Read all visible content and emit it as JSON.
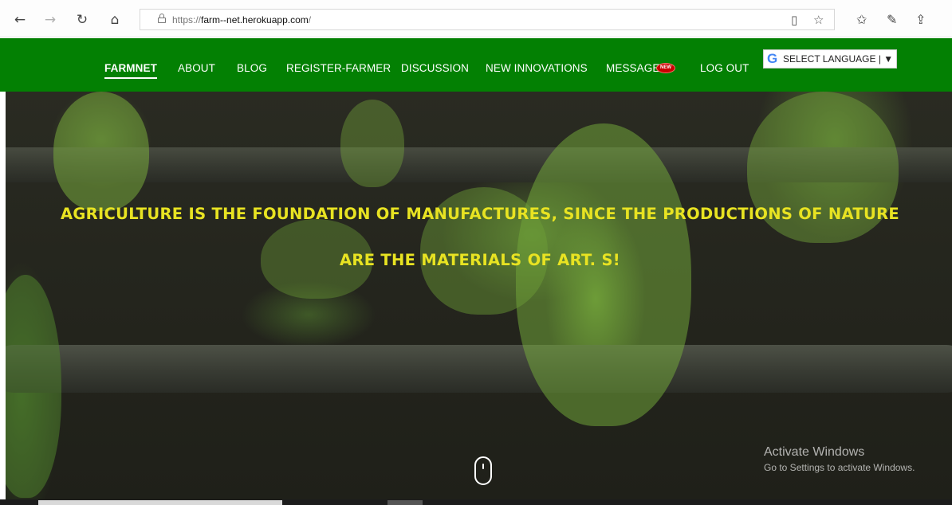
{
  "browser": {
    "url_prefix": "https://",
    "url_host": "farm--net.herokuapp.com",
    "url_suffix": "/",
    "icons": {
      "back": "←",
      "forward": "→",
      "refresh": "↻",
      "home": "⌂",
      "reading_view": "▯",
      "favorite": "☆",
      "favorites_list": "✩",
      "notes": "✎",
      "share": "⇪"
    }
  },
  "nav": {
    "brand": "FARMNET",
    "items": [
      {
        "label": "ABOUT"
      },
      {
        "label": "BLOG"
      },
      {
        "label": "REGISTER-FARMER"
      },
      {
        "label": "DISCUSSION"
      },
      {
        "label": "NEW INNOVATIONS"
      },
      {
        "label": "MESSAGE"
      },
      {
        "label": "LOG OUT"
      }
    ],
    "new_badge": "NEW",
    "language": {
      "logo": "G",
      "label": "SELECT LANGUAGE | ▼"
    },
    "colors": {
      "bar": "#038003",
      "badge": "#c90000"
    }
  },
  "hero": {
    "quote": "AGRICULTURE IS THE FOUNDATION OF MANUFACTURES, SINCE THE PRODUCTIONS OF NATURE\nARE THE MATERIALS OF ART. S!",
    "quote_color": "#e8e322"
  },
  "watermark": {
    "title": "Activate Windows",
    "subtitle": "Go to Settings to activate Windows."
  }
}
